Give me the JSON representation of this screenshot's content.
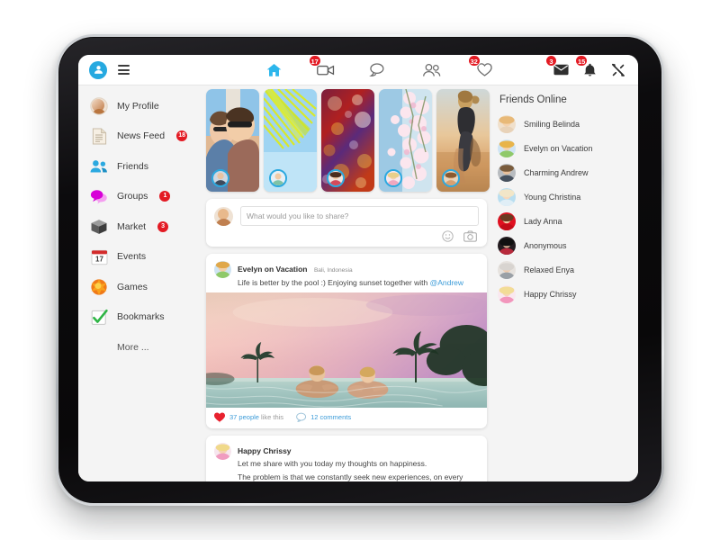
{
  "topbar": {
    "profile_icon": "user-avatar-icon",
    "menu_icon": "hamburger-menu-icon",
    "nav": [
      {
        "name": "home-icon",
        "label": "Home",
        "badge": null
      },
      {
        "name": "video-icon",
        "label": "Video",
        "badge": "17"
      },
      {
        "name": "chat-icon",
        "label": "Messages",
        "badge": null
      },
      {
        "name": "friends-icon",
        "label": "Friends",
        "badge": null
      },
      {
        "name": "heart-icon",
        "label": "Likes",
        "badge": "32"
      }
    ],
    "right": [
      {
        "name": "mail-icon",
        "label": "Inbox",
        "badge": "3"
      },
      {
        "name": "bell-icon",
        "label": "Notifications",
        "badge": "15"
      },
      {
        "name": "tools-icon",
        "label": "Settings",
        "badge": null
      }
    ]
  },
  "sidebar": {
    "items": [
      {
        "label": "My Profile",
        "icon": "profile-photo-icon",
        "badge": null
      },
      {
        "label": "News Feed",
        "icon": "document-icon",
        "badge": "18"
      },
      {
        "label": "Friends",
        "icon": "people-icon",
        "badge": null
      },
      {
        "label": "Groups",
        "icon": "speech-bubbles-icon",
        "badge": "1"
      },
      {
        "label": "Market",
        "icon": "box-icon",
        "badge": "3"
      },
      {
        "label": "Events",
        "icon": "calendar-icon",
        "badge": null,
        "day": "17"
      },
      {
        "label": "Games",
        "icon": "burst-icon",
        "badge": null
      },
      {
        "label": "Bookmarks",
        "icon": "checkmark-icon",
        "badge": null
      },
      {
        "label": "More ...",
        "icon": null,
        "badge": null
      }
    ]
  },
  "stories": [
    {
      "name": "story-couple-selfie"
    },
    {
      "name": "story-palm-leaf"
    },
    {
      "name": "story-bokeh-lights"
    },
    {
      "name": "story-cherry-blossom"
    },
    {
      "name": "story-beach-runner"
    }
  ],
  "composer": {
    "placeholder": "What would you like to share?",
    "value": "",
    "emoji_icon": "smiley-icon",
    "camera_icon": "camera-icon"
  },
  "posts": [
    {
      "author": "Evelyn on Vacation",
      "place": "Bali, Indonesia",
      "text": "Life is better by the pool :) Enjoying sunset together with ",
      "mention": "@Andrew",
      "photo": "sunset-infinity-pool-photo",
      "likes_count": "37 people",
      "likes_suffix": "like this",
      "comments": "12 comments"
    },
    {
      "author": "Happy Chrissy",
      "lead": "Let me share with you today my thoughts on happiness.",
      "body": "The problem is that we constantly seek new experiences, on every adventure our mind responds with new wishes. We always want something more and better. But happiness lies in not needing more"
    }
  ],
  "friends_online": {
    "title": "Friends Online",
    "items": [
      {
        "name": "Smiling Belinda"
      },
      {
        "name": "Evelyn on Vacation"
      },
      {
        "name": "Charming Andrew"
      },
      {
        "name": "Young Christina"
      },
      {
        "name": "Lady Anna"
      },
      {
        "name": "Anonymous"
      },
      {
        "name": "Relaxed Enya"
      },
      {
        "name": "Happy Chrissy"
      }
    ]
  },
  "colors": {
    "accent_blue": "#2ba9e0",
    "badge_red": "#e31a23",
    "link_blue": "#3b9bd8",
    "groups_magenta": "#d100d1",
    "games_orange": "#f08420",
    "bookmark_green": "#2eb545",
    "app_bg": "#f4f4f4"
  }
}
